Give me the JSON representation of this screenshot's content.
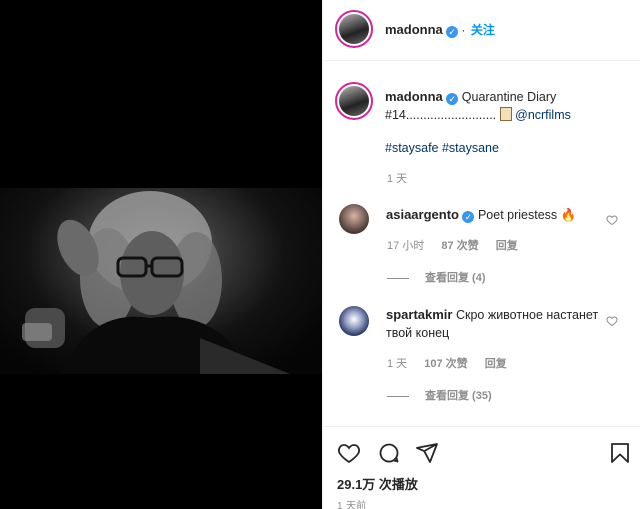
{
  "post": {
    "username": "madonna",
    "follow_label": "关注",
    "caption_text": "Quarantine Diary #14..........................",
    "caption_mention": "@ncrfilms",
    "hashtags": "#staysafe #staysane",
    "caption_time": "1 天"
  },
  "comments": [
    {
      "username": "asiaargento",
      "text": "Poet priestess 🔥",
      "time": "17 小时",
      "likes": "87 次赞",
      "reply_label": "回复",
      "view_replies": "查看回复 (4)"
    },
    {
      "username": "spartakmir",
      "text": "Скро животное настанет твой конец",
      "time": "1 天",
      "likes": "107 次赞",
      "reply_label": "回复",
      "view_replies": "查看回复 (35)"
    }
  ],
  "footer": {
    "views": "29.1万 次播放",
    "time": "1 天前"
  },
  "icons": {
    "like": "heart-icon",
    "comment": "comment-icon",
    "share": "share-icon",
    "save": "bookmark-icon"
  },
  "colors": {
    "accent": "#0095f6",
    "verified": "#3897f0",
    "link": "#00376b",
    "muted": "#8e8e8e"
  }
}
